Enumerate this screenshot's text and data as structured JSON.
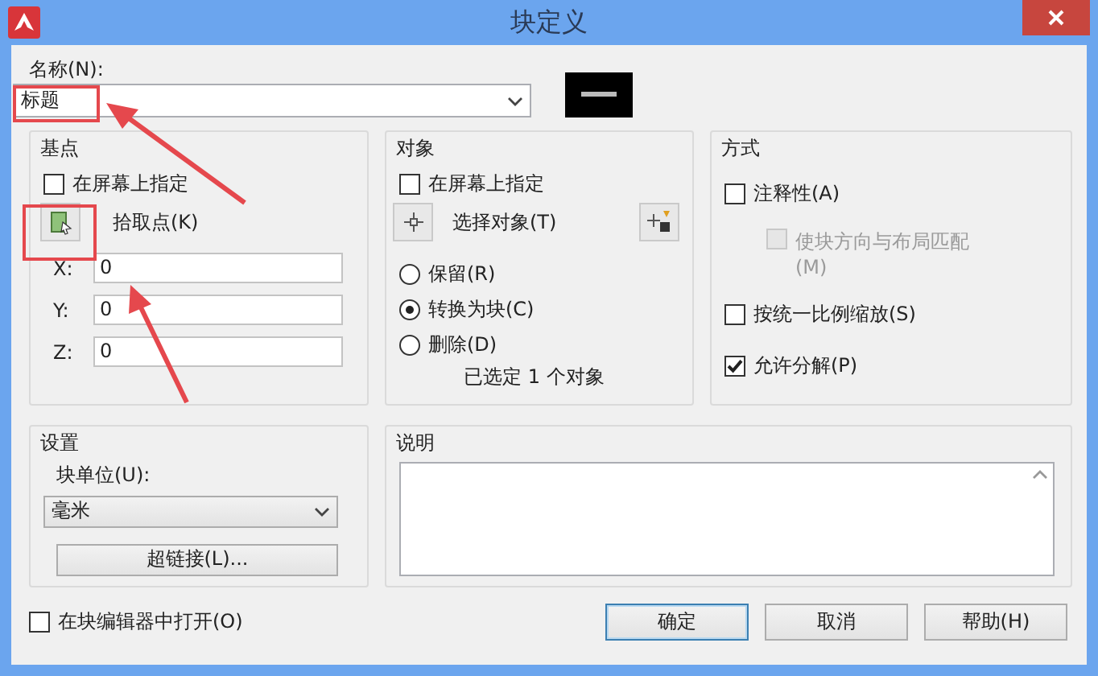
{
  "window": {
    "title": "块定义"
  },
  "name": {
    "label": "名称(N):",
    "value": "标题"
  },
  "base_point": {
    "title": "基点",
    "specify_on_screen": {
      "label": "在屏幕上指定",
      "checked": false
    },
    "pick_button": {
      "label": "拾取点(K)"
    },
    "coords": [
      {
        "label": "X:",
        "value": "0"
      },
      {
        "label": "Y:",
        "value": "0"
      },
      {
        "label": "Z:",
        "value": "0"
      }
    ]
  },
  "objects": {
    "title": "对象",
    "specify_on_screen": {
      "label": "在屏幕上指定",
      "checked": false
    },
    "select_button": {
      "label": "选择对象(T)"
    },
    "options": [
      {
        "label": "保留(R)",
        "selected": false
      },
      {
        "label": "转换为块(C)",
        "selected": true
      },
      {
        "label": "删除(D)",
        "selected": false
      }
    ],
    "summary": "已选定 1 个对象"
  },
  "behavior": {
    "title": "方式",
    "options": [
      {
        "label": "注释性(A)",
        "checked": false,
        "disabled": false,
        "children": [
          {
            "label": "使块方向与布局匹配(M)",
            "checked": false,
            "disabled": true
          }
        ]
      },
      {
        "label": "按统一比例缩放(S)",
        "checked": false,
        "disabled": false
      },
      {
        "label": "允许分解(P)",
        "checked": true,
        "disabled": false
      }
    ]
  },
  "settings": {
    "title": "设置",
    "unit_label": "块单位(U):",
    "unit_value": "毫米",
    "hyperlink_button": "超链接(L)..."
  },
  "description": {
    "title": "说明"
  },
  "open_in_editor": {
    "label": "在块编辑器中打开(O)",
    "checked": false
  },
  "buttons": [
    {
      "label": "确定",
      "default": true
    },
    {
      "label": "取消",
      "default": false
    },
    {
      "label": "帮助(H)",
      "default": false
    }
  ]
}
